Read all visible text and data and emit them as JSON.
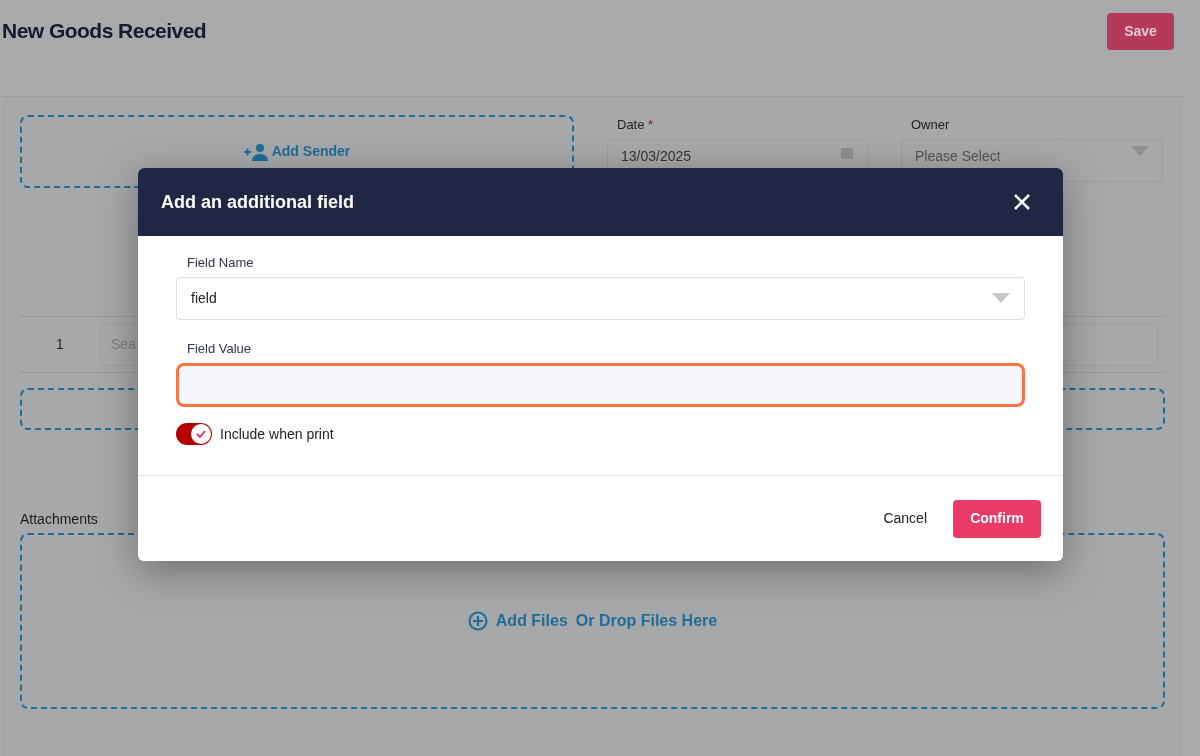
{
  "page": {
    "title": "New Goods Received",
    "save_button": "Save"
  },
  "form": {
    "add_sender": "Add Sender",
    "date": {
      "label": "Date",
      "required_mark": "*",
      "value": "13/03/2025"
    },
    "owner": {
      "label": "Owner",
      "placeholder": "Please Select"
    },
    "line_items": [
      {
        "number": "1",
        "search_placeholder": "Sea"
      }
    ],
    "attachments": {
      "label": "Attachments",
      "add_files": "Add Files",
      "drop_hint": "Or Drop Files Here"
    }
  },
  "dialog": {
    "title": "Add an additional field",
    "field_name": {
      "label": "Field Name",
      "value": "field"
    },
    "field_value": {
      "label": "Field Value",
      "focused": true
    },
    "include_when_print": {
      "label": "Include when print",
      "on": true
    },
    "buttons": {
      "cancel": "Cancel",
      "confirm": "Confirm"
    }
  }
}
